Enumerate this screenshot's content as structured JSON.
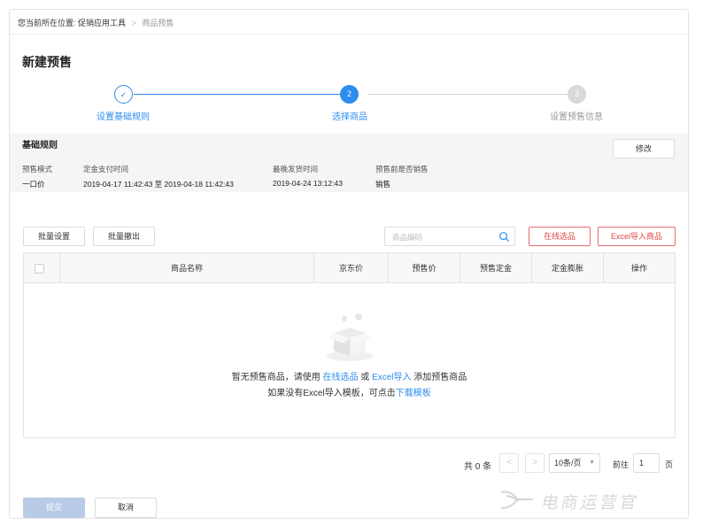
{
  "breadcrumb": {
    "prefix": "您当前所在位置:",
    "item1": "促销应用工具",
    "separator": ">",
    "current": "商品预售"
  },
  "page_title": "新建预售",
  "steps": [
    {
      "num": "✓",
      "label": "设置基础规则",
      "state": "done"
    },
    {
      "num": "2",
      "label": "选择商品",
      "state": "active"
    },
    {
      "num": "3",
      "label": "设置预售信息",
      "state": "todo"
    }
  ],
  "rules": {
    "title": "基础规则",
    "edit_label": "修改",
    "fields": [
      {
        "key": "预售模式",
        "value": "一口价"
      },
      {
        "key": "定金支付时间",
        "value": "2019-04-17 11:42:43 至 2019-04-18 11:42:43"
      },
      {
        "key": "最晚发货时间",
        "value": "2019-04-24 13:12:43"
      },
      {
        "key": "预售前是否销售",
        "value": "销售"
      }
    ]
  },
  "toolbar": {
    "batch_set": "批量设置",
    "batch_cancel": "批量撤出",
    "search_placeholder": "商品编码",
    "online_select": "在线选品",
    "excel_import": "Excel导入商品"
  },
  "table": {
    "columns": [
      "商品名称",
      "京东价",
      "预售价",
      "预售定金",
      "定金膨胀",
      "操作"
    ]
  },
  "empty": {
    "line1_a": "暂无预售商品，请使用 ",
    "line1_link1": "在线选品",
    "line1_b": " 或 ",
    "line1_link2": "Excel导入",
    "line1_c": " 添加预售商品",
    "line2_a": "如果没有Excel导入模板，可点击",
    "line2_link": "下载模板"
  },
  "pager": {
    "total": "共 0 条",
    "prev": "<",
    "next": ">",
    "page_size": "10条/页",
    "goto_label": "前往",
    "goto_value": "1",
    "goto_unit": "页"
  },
  "footer": {
    "submit": "提交",
    "cancel": "取消"
  },
  "watermark": "电商运营官",
  "colors": {
    "accent": "#2d8cf0",
    "danger": "#e04a4a",
    "disabled_submit": "#b9cbe6"
  }
}
